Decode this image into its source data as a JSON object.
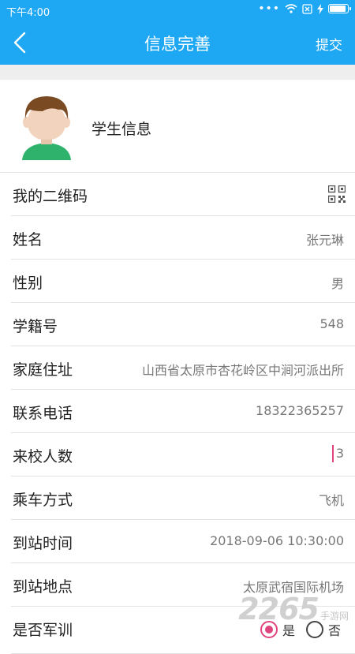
{
  "status_bar": {
    "time": "下午4:00",
    "signal_dots": "•••"
  },
  "nav": {
    "title": "信息完善",
    "submit_label": "提交"
  },
  "profile": {
    "label": "学生信息"
  },
  "rows": [
    {
      "label": "我的二维码",
      "icon": "qr-code-icon"
    },
    {
      "label": "姓名",
      "value": "张元琳"
    },
    {
      "label": "性别",
      "value": "男"
    },
    {
      "label": "学籍号",
      "value": "548"
    },
    {
      "label": "家庭住址",
      "value": "山西省太原市杏花岭区中涧河派出所"
    },
    {
      "label": "联系电话",
      "value": "18322365257"
    },
    {
      "label": "来校人数",
      "value": "3"
    },
    {
      "label": "乘车方式",
      "value": "飞机"
    },
    {
      "label": "到站时间",
      "value": "2018-09-06 10:30:00"
    },
    {
      "label": "到站地点",
      "value": "太原武宿国际机场"
    },
    {
      "label": "是否军训",
      "options": [
        "是",
        "否"
      ],
      "selected": "是"
    }
  ],
  "watermark": {
    "number": "2265",
    "text": "手游网"
  },
  "colors": {
    "primary": "#1ea7f3",
    "accent": "#e0447e",
    "avatar_shirt": "#2fb36c",
    "avatar_hair": "#7a4a22",
    "avatar_skin": "#f2d3bd"
  }
}
